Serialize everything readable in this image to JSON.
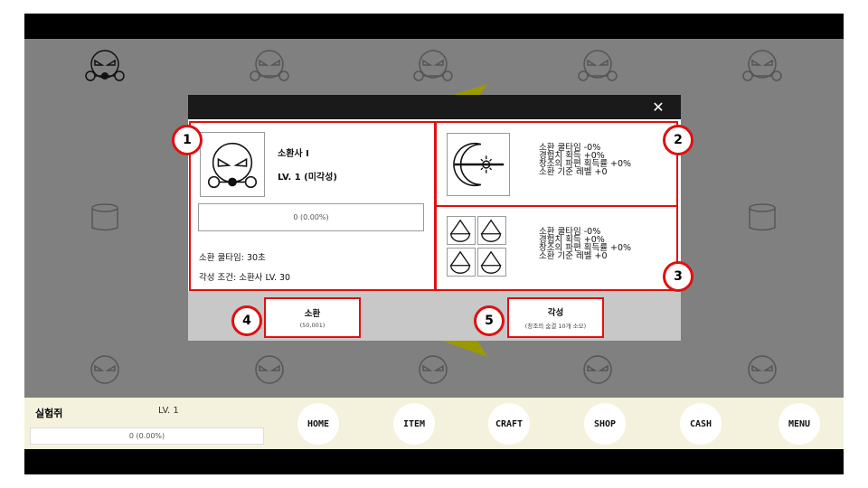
{
  "hud": {
    "player_name": "실험쥐",
    "level": "LV. 1",
    "exp_text": "0 (0.00%)",
    "exp_progress_percent": 0,
    "nav": [
      "HOME",
      "ITEM",
      "CRAFT",
      "SHOP",
      "CASH",
      "MENU"
    ]
  },
  "modal": {
    "close_symbol": "✕",
    "summoner": {
      "name": "소환사 I",
      "level": "LV. 1 (미각성)",
      "exp_text": "0 (0.00%)",
      "exp_progress_percent": 0,
      "cooldown": "소환 쿨타임: 30초",
      "awaken_condition": "각성 조건: 소환사 LV. 30"
    },
    "stats_primary": {
      "lines": [
        "소환 쿨타임 -0%",
        "경험치 획득 +0%",
        "창조의 파편 획득률 +0%",
        "소환 기준 레벨 +0"
      ]
    },
    "stats_secondary": {
      "lines": [
        "소환 쿨타임 -0%",
        "경험치 획득 +0%",
        "창조의 파편 획득률 +0%",
        "소환 기준 레벨 +0"
      ]
    },
    "summon_button": {
      "label": "소환",
      "cost": "(50,001)"
    },
    "awaken_button": {
      "label": "각성",
      "cost": "(창조의 숨결 10개 소모)"
    }
  },
  "markers": [
    "1",
    "2",
    "3",
    "4",
    "5"
  ],
  "colors": {
    "background": "#808080",
    "hud": "#f4f2dc",
    "modal_header": "#1a1a1a",
    "modal_footer": "#c8c8c8",
    "highlight": "#e01010",
    "shard": "#9a9a00"
  }
}
